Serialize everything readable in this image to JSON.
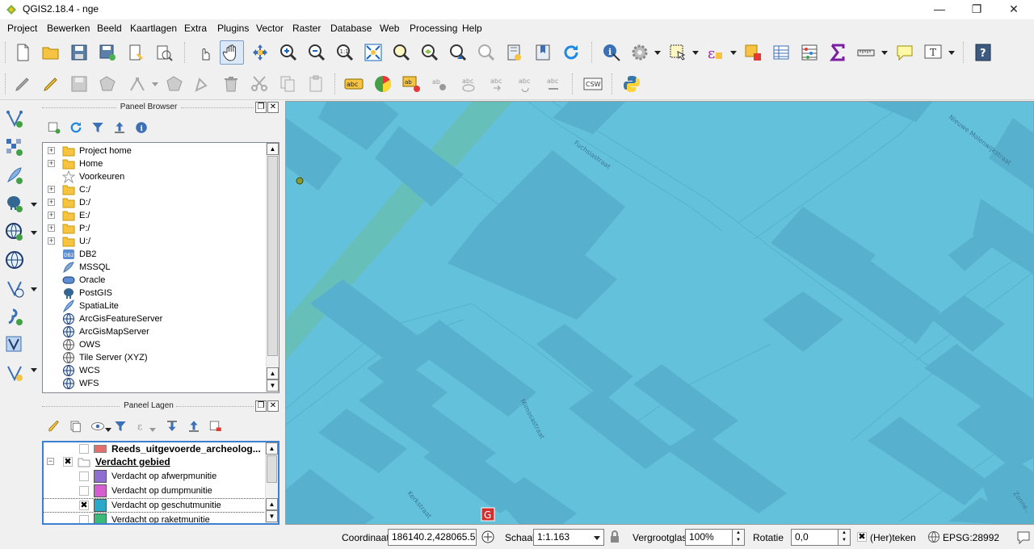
{
  "window": {
    "title": "QGIS2.18.4 - nge",
    "minimize": "—",
    "maximize": "❐",
    "close": "✕"
  },
  "menu": [
    "Project",
    "Bewerken",
    "Beeld",
    "Kaartlagen",
    "Extra",
    "Plugins",
    "Vector",
    "Raster",
    "Database",
    "Web",
    "Processing",
    "Help"
  ],
  "panels": {
    "browser": {
      "title": "Paneel Browser",
      "items": [
        "Project home",
        "Home",
        "Voorkeuren",
        "C:/",
        "D:/",
        "E:/",
        "P:/",
        "U:/",
        "DB2",
        "MSSQL",
        "Oracle",
        "PostGIS",
        "SpatiaLite",
        "ArcGisFeatureServer",
        "ArcGisMapServer",
        "OWS",
        "Tile Server (XYZ)",
        "WCS",
        "WFS"
      ]
    },
    "layers": {
      "title": "Paneel Lagen",
      "rows": [
        {
          "label": "Reeds_uitgevoerde_archeolog...",
          "checked": false,
          "color": "#e07070",
          "style": "bold"
        },
        {
          "label": "Verdacht gebied",
          "checked": true,
          "color": "",
          "style": "group"
        },
        {
          "label": "Verdacht op afwerpmunitie",
          "checked": false,
          "color": "#8e6fcf",
          "style": "normal"
        },
        {
          "label": "Verdacht op dumpmunitie",
          "checked": false,
          "color": "#d65fd0",
          "style": "normal"
        },
        {
          "label": "Verdacht op geschutmunitie",
          "checked": true,
          "color": "#2aa8c9",
          "style": "normal"
        },
        {
          "label": "Verdacht op raketmunitie",
          "checked": false,
          "color": "#3cb878",
          "style": "normal"
        }
      ]
    }
  },
  "map": {
    "background": "#64c1dc",
    "street_labels": [
      "Fuchsiastraat",
      "Mimosastraat",
      "Kerkstraat",
      "Zonne..",
      "Nieuwe Molenwijkstraat"
    ],
    "marker_label": "G"
  },
  "toolbar": {
    "label_tool": "abc",
    "csw": "CSW",
    "tile_text": "1:1"
  },
  "status": {
    "coordinate_label": "Coordinaat",
    "coordinate_value": "186140.2,428065.5",
    "scale_label": "Schaal",
    "scale_value": "1:1.163",
    "magnifier_label": "Vergrootglas",
    "magnifier_value": "100%",
    "rotation_label": "Rotatie",
    "rotation_value": "0,0",
    "render_label": "(Her)teken",
    "render_checked": true,
    "epsg": "EPSG:28992"
  }
}
